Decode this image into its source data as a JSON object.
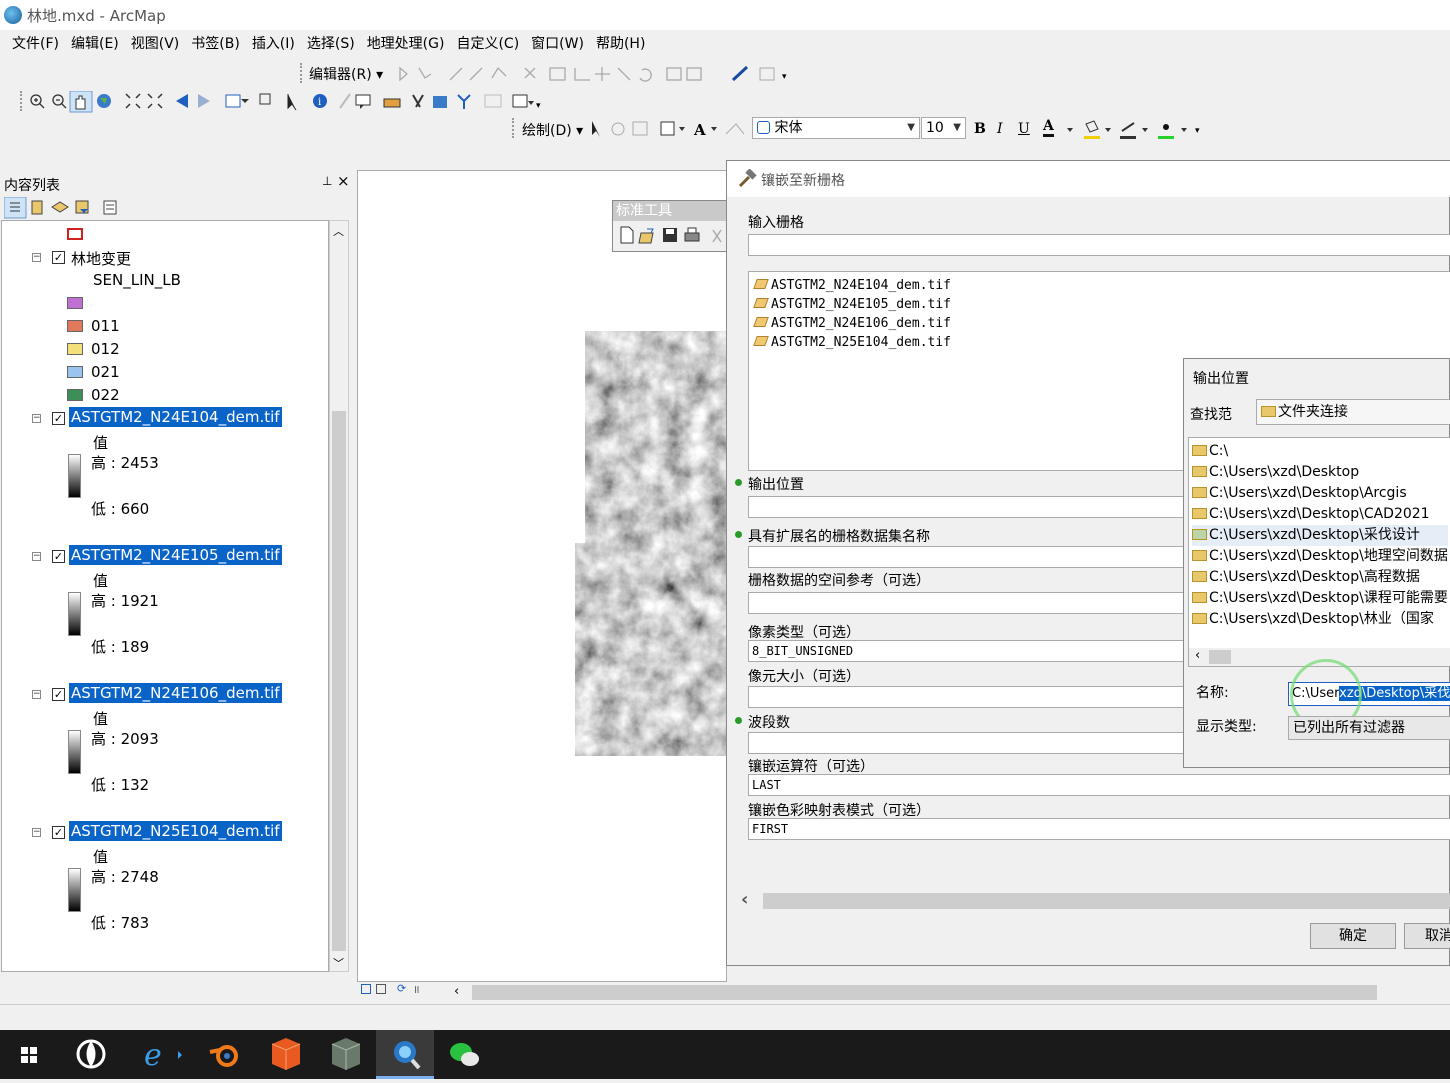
{
  "window": {
    "title": "林地.mxd - ArcMap",
    "icon": "arcmap-icon"
  },
  "menu": [
    "文件(F)",
    "编辑(E)",
    "视图(V)",
    "书签(B)",
    "插入(I)",
    "选择(S)",
    "地理处理(G)",
    "自定义(C)",
    "窗口(W)",
    "帮助(H)"
  ],
  "toolbar": {
    "editor_label": "编辑器(R)",
    "draw_label": "绘制(D)",
    "font_name": "宋体",
    "font_size": "10",
    "bold": "B",
    "italic": "I",
    "underline": "U",
    "font_color": "A"
  },
  "toc": {
    "title": "内容列表",
    "pin": "ᵽ",
    "close": "×",
    "group_layer": "林地变更",
    "field_name": "SEN_LIN_LB",
    "classes": [
      {
        "label": "",
        "color": "#c070d0"
      },
      {
        "label": "011",
        "color": "#e07a5a"
      },
      {
        "label": "012",
        "color": "#f4e07a"
      },
      {
        "label": "021",
        "color": "#9ac4ef"
      },
      {
        "label": "022",
        "color": "#3e8e5a"
      }
    ],
    "rasters": [
      {
        "name": "ASTGTM2_N24E104_dem.tif",
        "value_label": "值",
        "high": "高 : 2453",
        "low": "低 : 660"
      },
      {
        "name": "ASTGTM2_N24E105_dem.tif",
        "value_label": "值",
        "high": "高 : 1921",
        "low": "低 : 189"
      },
      {
        "name": "ASTGTM2_N24E106_dem.tif",
        "value_label": "值",
        "high": "高 : 2093",
        "low": "低 : 132"
      },
      {
        "name": "ASTGTM2_N25E104_dem.tif",
        "value_label": "值",
        "high": "高 : 2748",
        "low": "低 : 783"
      }
    ]
  },
  "std_tools": {
    "title": "标准工具"
  },
  "dialog": {
    "title": "镶嵌至新栅格",
    "input_label": "输入栅格",
    "input_files": [
      "ASTGTM2_N24E104_dem.tif",
      "ASTGTM2_N24E105_dem.tif",
      "ASTGTM2_N24E106_dem.tif",
      "ASTGTM2_N25E104_dem.tif"
    ],
    "output_location_label": "输出位置",
    "dataset_name_label": "具有扩展名的栅格数据集名称",
    "spatial_ref_label": "栅格数据的空间参考（可选）",
    "pixel_type_label": "像素类型（可选）",
    "pixel_type_value": "8_BIT_UNSIGNED",
    "cellsize_label": "像元大小（可选）",
    "bands_label": "波段数",
    "mosaic_operator_label": "镶嵌运算符（可选）",
    "mosaic_operator_value": "LAST",
    "colormap_label": "镶嵌色彩映射表模式（可选）",
    "colormap_value": "FIRST",
    "ok": "确定",
    "cancel": "取消"
  },
  "output_dialog": {
    "title": "输出位置",
    "look_in_label": "查找范",
    "look_in_value": "文件夹连接",
    "folders": [
      "C:\\",
      "C:\\Users\\xzd\\Desktop",
      "C:\\Users\\xzd\\Desktop\\Arcgis",
      "C:\\Users\\xzd\\Desktop\\CAD2021",
      "C:\\Users\\xzd\\Desktop\\采伐设计",
      "C:\\Users\\xzd\\Desktop\\地理空间数据",
      "C:\\Users\\xzd\\Desktop\\高程数据",
      "C:\\Users\\xzd\\Desktop\\课程可能需要",
      "C:\\Users\\xzd\\Desktop\\林业（国家"
    ],
    "name_label": "名称:",
    "name_value_prefix": "C:\\User",
    "name_value_selected": "xzd\\Desktop\\采伐",
    "display_type_label": "显示类型:",
    "display_type_value": "已列出所有过滤器"
  },
  "taskbar": {
    "apps": [
      "start-icon",
      "pinwheel-icon",
      "ie-icon",
      "blender-icon",
      "box-app-icon",
      "package-icon",
      "arcmap-icon",
      "wechat-icon"
    ]
  }
}
